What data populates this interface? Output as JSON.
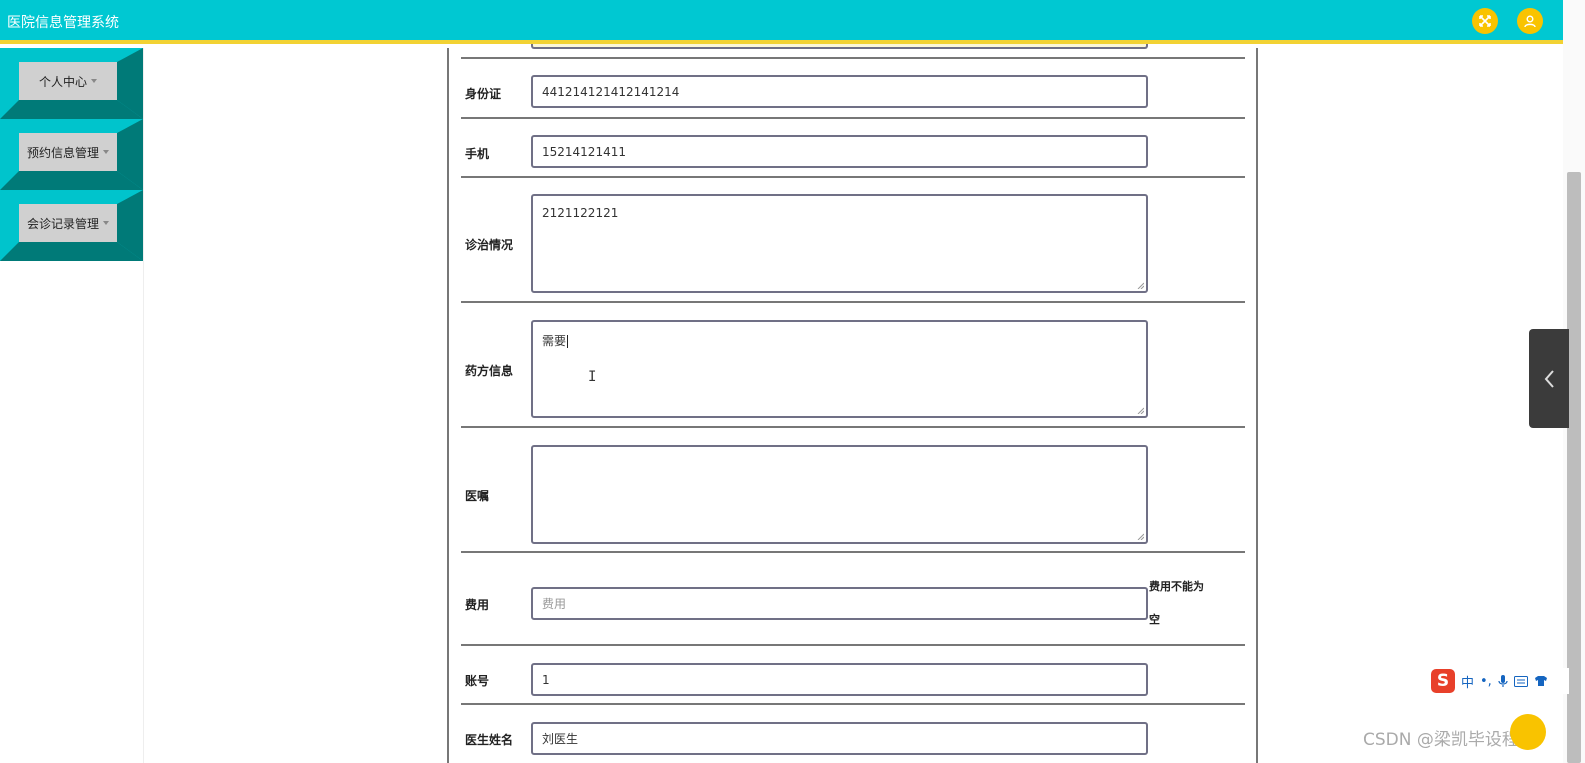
{
  "app": {
    "title": "医院信息管理系统"
  },
  "header": {
    "fullscreen_icon": "expand-arrows-icon",
    "user_icon": "user-icon"
  },
  "sidebar": {
    "items": [
      {
        "label": "个人中心"
      },
      {
        "label": "预约信息管理"
      },
      {
        "label": "会诊记录管理"
      }
    ]
  },
  "form": {
    "id_card": {
      "label": "身份证",
      "value": "441214121412141214"
    },
    "phone": {
      "label": "手机",
      "value": "15214121411"
    },
    "diagnosis": {
      "label": "诊治情况",
      "value": "2121122121"
    },
    "prescription": {
      "label": "药方信息",
      "value": "需要"
    },
    "doctor_advice": {
      "label": "医嘱",
      "value": ""
    },
    "fee": {
      "label": "费用",
      "value": "",
      "placeholder": "费用",
      "error_line1": "费用不能为",
      "error_line2": "空"
    },
    "account": {
      "label": "账号",
      "value": "1"
    },
    "doctor_name": {
      "label": "医生姓名",
      "value": "刘医生"
    }
  },
  "ime": {
    "logo": "S",
    "mode": "中",
    "punct": "•,",
    "mic_icon": "microphone-icon",
    "keyboard_icon": "keyboard-icon",
    "skin_icon": "shirt-icon"
  },
  "watermark": "CSDN @梁凯毕设程序",
  "colors": {
    "header_bg": "#00c8d2",
    "header_accent": "#f2d233",
    "sidebar_teal": "#00c4cc",
    "sidebar_dark": "#007a78",
    "button_yellow": "#f9c300"
  }
}
